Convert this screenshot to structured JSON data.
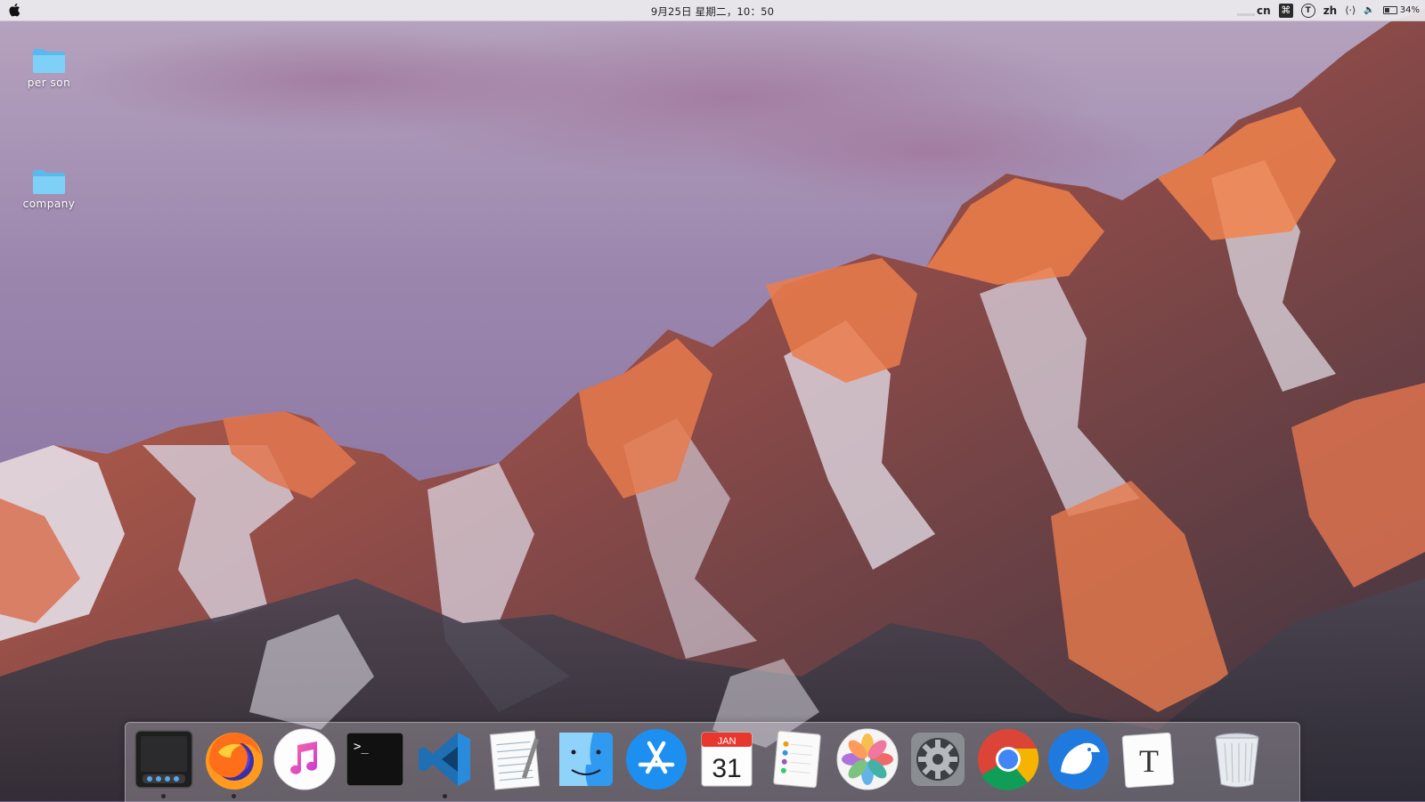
{
  "menubar": {
    "datetime": "9月25日 星期二，10：50",
    "status": {
      "input_cn": "cn",
      "cmd_symbol": "⌘",
      "accessibility_symbol": "T",
      "lang": "zh",
      "network_symbol": "⟨·⟩",
      "volume_symbol": "🔈",
      "battery_percent": "34%"
    }
  },
  "desktop": {
    "icons": [
      {
        "label": "per son",
        "icon": "folder-icon"
      },
      {
        "label": "company",
        "icon": "folder-icon"
      }
    ]
  },
  "dock": {
    "items": [
      {
        "name": "launchpad",
        "icon": "launchpad-icon",
        "running": true
      },
      {
        "name": "firefox",
        "icon": "firefox-icon",
        "running": true
      },
      {
        "name": "music",
        "icon": "music-icon",
        "running": false
      },
      {
        "name": "terminal",
        "icon": "terminal-icon",
        "running": false,
        "prompt": ">_"
      },
      {
        "name": "vscode",
        "icon": "vscode-icon",
        "running": true
      },
      {
        "name": "textedit",
        "icon": "notepad-icon",
        "running": false
      },
      {
        "name": "finder",
        "icon": "finder-icon",
        "running": false
      },
      {
        "name": "app-store",
        "icon": "app-store-icon",
        "running": false
      },
      {
        "name": "calendar",
        "icon": "calendar-icon",
        "running": false,
        "month": "JAN",
        "day": "31"
      },
      {
        "name": "reminders",
        "icon": "reminders-icon",
        "running": false
      },
      {
        "name": "photos",
        "icon": "photos-icon",
        "running": false
      },
      {
        "name": "system-preferences",
        "icon": "gear-icon",
        "running": false
      },
      {
        "name": "chrome",
        "icon": "chrome-icon",
        "running": false
      },
      {
        "name": "eagle",
        "icon": "eagle-icon",
        "running": false
      },
      {
        "name": "typora",
        "icon": "typora-icon",
        "running": false,
        "letter": "T"
      },
      {
        "name": "trash",
        "icon": "trash-icon",
        "running": false
      }
    ]
  }
}
